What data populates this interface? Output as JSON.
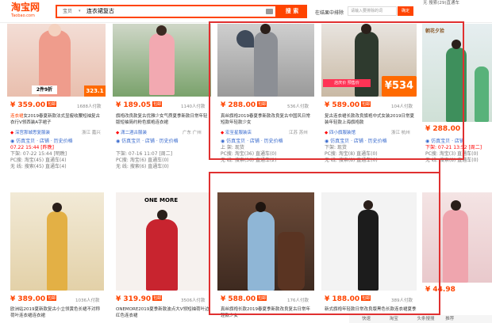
{
  "header": {
    "logo": "淘宝网",
    "logo_sub": "Taobao.com",
    "search_scope": "宝贝",
    "query": "连衣裙复古",
    "search_button": "搜 索",
    "insert_label": "在结果中排除",
    "insert_placeholder": "请输入要排除的词",
    "insert_button": "确定",
    "topright": [
      "无 搜索(29)直通车",
      "全部",
      "8小时发货"
    ]
  },
  "row1": [
    {
      "promo": "2件9折",
      "promo_price": "323.1",
      "price": "¥ 359.00",
      "sold": "1688人付款",
      "title_kw": "连衣裙",
      "title": "女2019春夏新款法式显瘦收腰短袖复古衣行V领西装A字裙子",
      "shop": "深宫那城思复服装",
      "loc": "浙江 嘉兴",
      "meta": [
        "仿真宝贝",
        "店铺",
        "历史价格"
      ],
      "ts": "07.22 15:44 [昨晚]",
      "line5": "下架: 07-22 15:44 [明晚]",
      "line6": "PC搜: 淘宝(45) 直通车(4)",
      "line7": "无 线: 搜索(45) 直通车(4)"
    },
    {
      "price": "¥ 189.05",
      "sold": "1140人付款",
      "title": "旗袍改良款复古优雅少女气质夏季新款日常年轻版短袖简约粉色旗袍连衣裙",
      "shop": "潇二酒古服装",
      "loc": "广东 广州",
      "meta": [
        "仿真宝贝",
        "店铺",
        "历史价格"
      ],
      "line5": "下架: 07-16 11:07 [周二]",
      "line6": "PC搜: 淘宝(6) 直通车(0)",
      "line7": "无 线: 搜索(6) 直通车(0)"
    },
    {
      "price": "¥ 288.00",
      "sold": "536人付款",
      "title": "真丝旗袍2019春夏季新款改良复古中国风日常短款年轻款少女",
      "shop": "宏至星服装店",
      "loc": "江苏 苏州",
      "meta": [
        "仿真宝贝",
        "店铺",
        "历史价格"
      ],
      "line5": "上 架: 现货",
      "line6": "PC搜: 淘宝(36) 直通车(0)",
      "line7": "无 线: 搜索(36) 直通车(2)"
    },
    {
      "promo_price": "534",
      "price": "¥ 589.00",
      "sold": "104人付款",
      "title": "复古连衣裙长款改良旗袍中式女装2019日常夏装年轻款上海旗袍款",
      "shop": "四小旗服装馆",
      "loc": "浙江 杭州",
      "meta": [
        "仿真宝贝",
        "店铺",
        "历史价格"
      ],
      "line5": "下架: 现货",
      "line6": "PC搜: 淘宝(8) 直通车(0)",
      "line7": "无 线: 搜索(8) 直通车(0)"
    },
    {
      "price": "¥ 288.00",
      "meta": [
        "仿真宝贝",
        "店铺",
        "历史价格"
      ],
      "line5": "下架: 07-21 13:52 [周二]",
      "line6": "PC搜: 淘宝(3) 直通车(0)",
      "line7": "无 线: 搜索(8) 直通车(0)"
    }
  ],
  "row2": [
    {
      "price": "¥ 389.00",
      "sold": "1036人付款",
      "title": "欧洲站2019夏新款复古小立领黄色长裙不对称荷叶连衣裙连衣裙"
    },
    {
      "brand": "ONE MORE",
      "price": "¥ 319.90",
      "sold": "3506人付款",
      "title": "ONEMORE2019夏季新款波点大V领短袖荷叶边红色连衣裙"
    },
    {
      "price": "¥ 588.00",
      "sold": "176人付款",
      "title": "真丝旗袍长款2019春夏季新款改良复古日常年轻款少女"
    },
    {
      "price": "¥ 188.00",
      "sold": "389人付款",
      "title": "新式旗袍年轻款日常改良版黑色长款连衣裙夏季"
    },
    {
      "price": "¥ 44.98"
    }
  ],
  "footer": [
    "快速",
    "淘宝",
    "头条搜搜",
    "推荐"
  ],
  "colors": {
    "accent": "#ff4400",
    "box": "#e03030"
  }
}
